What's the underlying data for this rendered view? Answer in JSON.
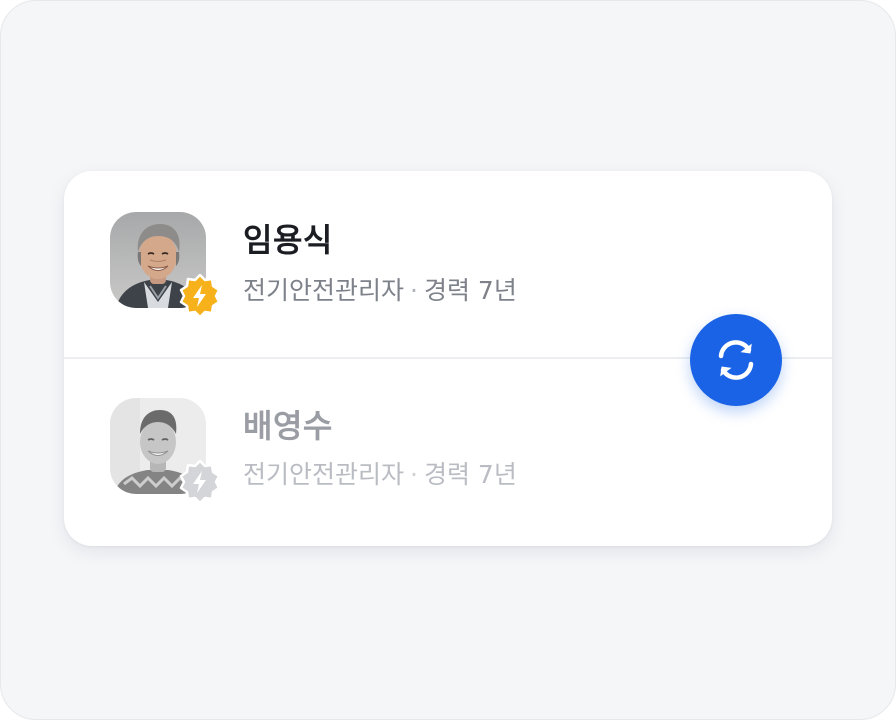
{
  "colors": {
    "accent": "#1a63e6",
    "badge_active": "#f7b21b",
    "badge_inactive": "#d4d5d8",
    "background": "#f5f6f8",
    "card": "#ffffff"
  },
  "profiles": [
    {
      "name": "임용식",
      "role": "전기안전관리자",
      "separator": "·",
      "experience": "경력 7년",
      "state": "active",
      "badge_icon": "lightning-icon"
    },
    {
      "name": "배영수",
      "role": "전기안전관리자",
      "separator": "·",
      "experience": "경력 7년",
      "state": "inactive",
      "badge_icon": "lightning-icon"
    }
  ],
  "swap_button": {
    "icon": "refresh-icon",
    "state": "enabled"
  }
}
